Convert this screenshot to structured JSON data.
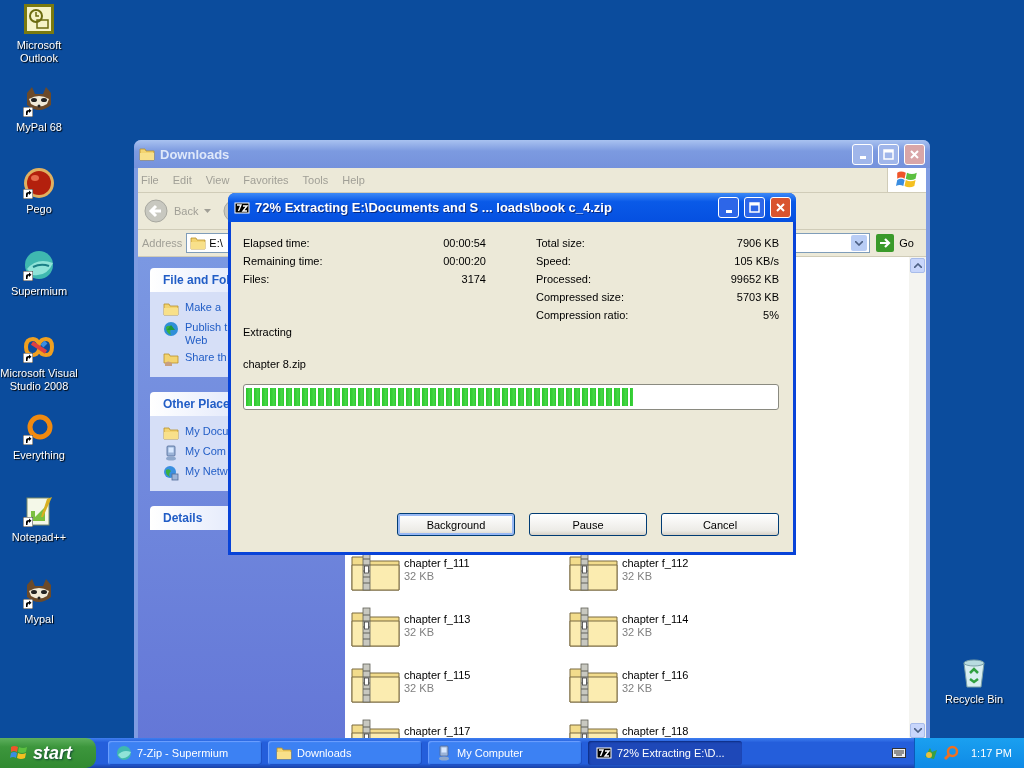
{
  "desktop_icons": [
    {
      "label": "Microsoft Outlook",
      "kind": "outlook",
      "shortcut": false
    },
    {
      "label": "MyPal 68",
      "kind": "raccoon",
      "shortcut": true
    },
    {
      "label": "Pego",
      "kind": "pego",
      "shortcut": true
    },
    {
      "label": "Supermium",
      "kind": "supermium",
      "shortcut": true
    },
    {
      "label": "Microsoft Visual Studio 2008",
      "kind": "studio",
      "shortcut": true
    },
    {
      "label": "Everything",
      "kind": "ring",
      "shortcut": true
    },
    {
      "label": "Notepad++",
      "kind": "notepad",
      "shortcut": true
    },
    {
      "label": "Mypal",
      "kind": "raccoon",
      "shortcut": true
    }
  ],
  "recycle_bin": {
    "label": "Recycle Bin"
  },
  "explorer": {
    "title": "Downloads",
    "menu": [
      "File",
      "Edit",
      "View",
      "Favorites",
      "Tools",
      "Help"
    ],
    "back": "Back",
    "address": {
      "label": "Address",
      "value": "E:\\"
    },
    "go": "Go",
    "task_panes": [
      {
        "title": "File and Fol",
        "items": [
          {
            "kind": "folder",
            "lines": [
              "Make a"
            ]
          },
          {
            "kind": "globe",
            "lines": [
              "Publish t",
              "Web"
            ]
          },
          {
            "kind": "share",
            "lines": [
              "Share th"
            ]
          }
        ]
      },
      {
        "title": "Other Place",
        "items": [
          {
            "kind": "folder",
            "lines": [
              "My Docu"
            ]
          },
          {
            "kind": "computer",
            "lines": [
              "My Com"
            ]
          },
          {
            "kind": "network",
            "lines": [
              "My Netw"
            ]
          }
        ]
      },
      {
        "title": "Details"
      }
    ],
    "files": [
      {
        "name": "chapter f_111",
        "size": "32 KB"
      },
      {
        "name": "chapter f_112",
        "size": "32 KB"
      },
      {
        "name": "chapter f_113",
        "size": "32 KB"
      },
      {
        "name": "chapter f_114",
        "size": "32 KB"
      },
      {
        "name": "chapter f_115",
        "size": "32 KB"
      },
      {
        "name": "chapter f_116",
        "size": "32 KB"
      },
      {
        "name": "chapter f_117"
      },
      {
        "name": "chapter f_118"
      }
    ]
  },
  "dialog": {
    "title": "72% Extracting E:\\Documents and S ... loads\\book c_4.zip",
    "stats_left": [
      {
        "label": "Elapsed time:",
        "value": "00:00:54"
      },
      {
        "label": "Remaining time:",
        "value": "00:00:20"
      },
      {
        "label": "Files:",
        "value": "3174"
      }
    ],
    "stats_right": [
      {
        "label": "Total size:",
        "value": "7906 KB"
      },
      {
        "label": "Speed:",
        "value": "105 KB/s"
      },
      {
        "label": "Processed:",
        "value": "99652 KB"
      },
      {
        "label": "Compressed size:",
        "value": "5703 KB"
      },
      {
        "label": "Compression ratio:",
        "value": "5%"
      }
    ],
    "status": "Extracting",
    "current_file": "chapter 8.zip",
    "progress": {
      "level": 0.73
    },
    "buttons": [
      "Background",
      "Pause",
      "Cancel"
    ]
  },
  "taskbar": {
    "start": "start",
    "tasks": [
      {
        "label": "7-Zip - Supermium",
        "kind": "browser",
        "selected": false
      },
      {
        "label": "Downloads",
        "kind": "folder",
        "selected": false
      },
      {
        "label": "My Computer",
        "kind": "computer",
        "selected": false
      },
      {
        "label": "72% Extracting E:\\D...",
        "kind": "archiver",
        "selected": true
      }
    ],
    "clock": "1:17 PM"
  }
}
